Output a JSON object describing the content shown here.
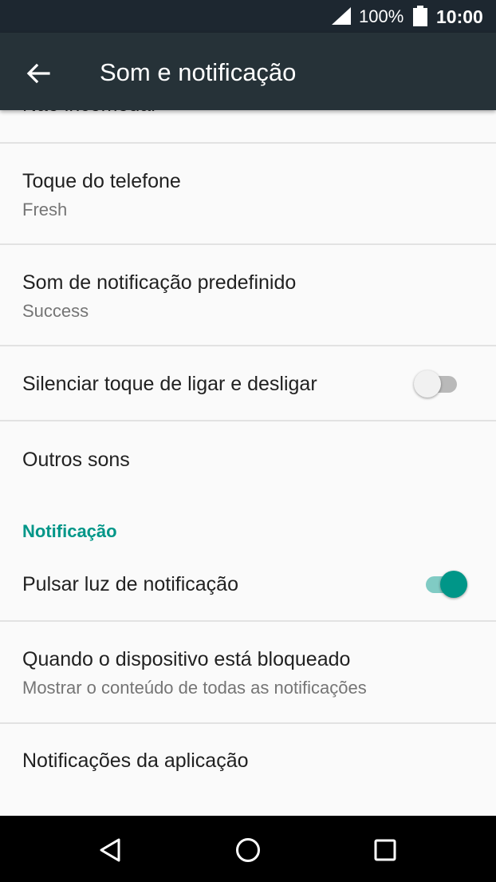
{
  "status_bar": {
    "battery_percent": "100%",
    "time": "10:00",
    "icons": [
      "signal-icon",
      "battery-icon"
    ]
  },
  "app_bar": {
    "title": "Som e notificação",
    "back_icon": "arrow-back-icon"
  },
  "settings": {
    "partial_item_label": "Não incomodar",
    "ringtone": {
      "title": "Toque do telefone",
      "value": "Fresh"
    },
    "notification_sound": {
      "title": "Som de notificação predefinido",
      "value": "Success"
    },
    "mute_power_sound": {
      "title": "Silenciar toque de ligar e desligar",
      "enabled": false
    },
    "other_sounds": {
      "title": "Outros sons"
    }
  },
  "notification_section": {
    "header": "Notificação",
    "pulse_light": {
      "title": "Pulsar luz de notificação",
      "enabled": true
    },
    "locked_device": {
      "title": "Quando o dispositivo está bloqueado",
      "value": "Mostrar o conteúdo de todas as notificações"
    },
    "app_notifications": {
      "title": "Notificações da aplicação"
    }
  },
  "nav_bar": {
    "icons": [
      "back-triangle-icon",
      "home-circle-icon",
      "recents-square-icon"
    ]
  },
  "colors": {
    "status_bar": "#1d2730",
    "app_bar": "#263238",
    "accent": "#009688",
    "background": "#fafafa"
  }
}
